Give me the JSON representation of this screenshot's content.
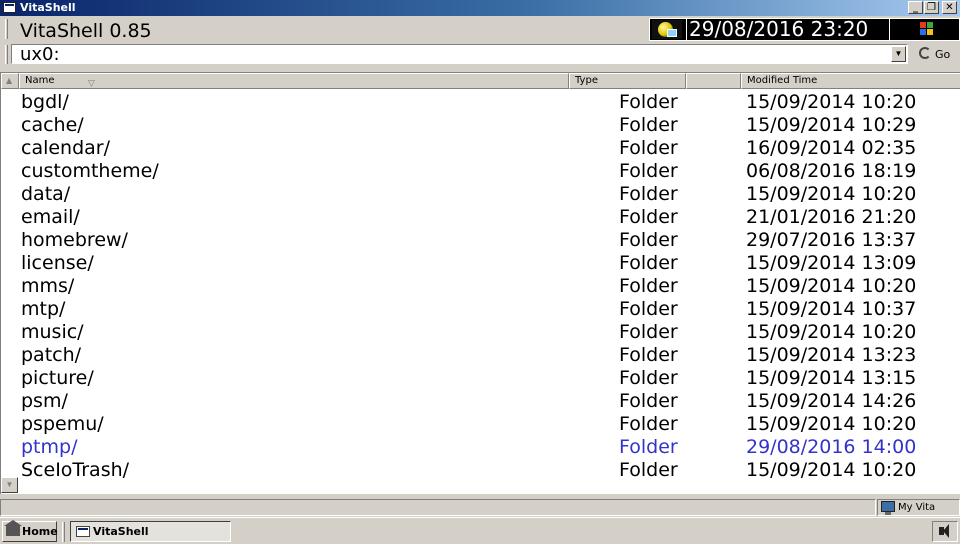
{
  "window": {
    "title": "VitaShell"
  },
  "header": {
    "app_title": "VitaShell 0.85",
    "datetime": "29/08/2016  23:20"
  },
  "address": {
    "path": "ux0:",
    "go_label": "Go"
  },
  "columns": {
    "name": "Name",
    "type": "Type",
    "modified": "Modified Time"
  },
  "files": [
    {
      "name": "bgdl/",
      "type": "Folder",
      "modified": "15/09/2014 10:20"
    },
    {
      "name": "cache/",
      "type": "Folder",
      "modified": "15/09/2014 10:29"
    },
    {
      "name": "calendar/",
      "type": "Folder",
      "modified": "16/09/2014 02:35"
    },
    {
      "name": "customtheme/",
      "type": "Folder",
      "modified": "06/08/2016 18:19"
    },
    {
      "name": "data/",
      "type": "Folder",
      "modified": "15/09/2014 10:20"
    },
    {
      "name": "email/",
      "type": "Folder",
      "modified": "21/01/2016 21:20"
    },
    {
      "name": "homebrew/",
      "type": "Folder",
      "modified": "29/07/2016 13:37"
    },
    {
      "name": "license/",
      "type": "Folder",
      "modified": "15/09/2014 13:09"
    },
    {
      "name": "mms/",
      "type": "Folder",
      "modified": "15/09/2014 10:20"
    },
    {
      "name": "mtp/",
      "type": "Folder",
      "modified": "15/09/2014 10:37"
    },
    {
      "name": "music/",
      "type": "Folder",
      "modified": "15/09/2014 10:20"
    },
    {
      "name": "patch/",
      "type": "Folder",
      "modified": "15/09/2014 13:23"
    },
    {
      "name": "picture/",
      "type": "Folder",
      "modified": "15/09/2014 13:15"
    },
    {
      "name": "psm/",
      "type": "Folder",
      "modified": "15/09/2014 14:26"
    },
    {
      "name": "pspemu/",
      "type": "Folder",
      "modified": "15/09/2014 10:20"
    },
    {
      "name": "ptmp/",
      "type": "Folder",
      "modified": "29/08/2016 14:00",
      "selected": true
    },
    {
      "name": "SceIoTrash/",
      "type": "Folder",
      "modified": "15/09/2014 10:20"
    }
  ],
  "statusbar": {
    "location": "My Vita"
  },
  "taskbar": {
    "start_label": "Home",
    "task_label": "VitaShell"
  },
  "colors": {
    "selected_text": "#3333cc",
    "titlebar_start": "#0a246a",
    "face": "#d4d0c8"
  },
  "icons": {
    "titlebar": "window-icon",
    "status": "network-globe-icon",
    "battery": "windows-flag-icon",
    "go": "go-arrow-icon",
    "computer": "computer-icon",
    "home": "home-icon",
    "volume": "speaker-icon"
  }
}
